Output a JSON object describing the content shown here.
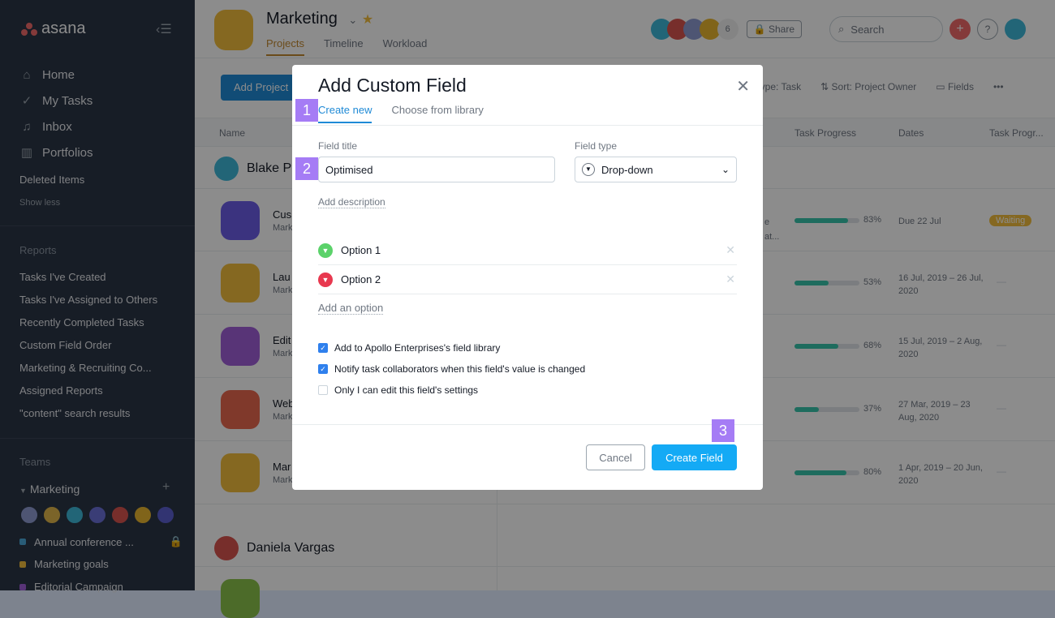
{
  "sidebar": {
    "brand": "asana",
    "nav": [
      {
        "icon": "home-icon",
        "label": "Home"
      },
      {
        "icon": "check-circle-icon",
        "label": "My Tasks"
      },
      {
        "icon": "bell-icon",
        "label": "Inbox"
      },
      {
        "icon": "bar-chart-icon",
        "label": "Portfolios"
      }
    ],
    "deleted": "Deleted Items",
    "show_less": "Show less",
    "reports_heading": "Reports",
    "reports": [
      "Tasks I've Created",
      "Tasks I've Assigned to Others",
      "Recently Completed Tasks",
      "Custom Field Order",
      "Marketing & Recruiting Co...",
      "Assigned Reports",
      "\"content\" search results"
    ],
    "teams_heading": "Teams",
    "team": "Marketing",
    "projects": [
      {
        "label": "Annual conference ...",
        "color": "#4ba8d9"
      },
      {
        "label": "Marketing goals",
        "color": "#f1bd3c"
      },
      {
        "label": "Editorial Campaign",
        "color": "#a05fd8"
      }
    ]
  },
  "header": {
    "title": "Marketing",
    "tabs": [
      "Projects",
      "Timeline",
      "Workload"
    ],
    "member_count": "6",
    "share": "Share",
    "search_placeholder": "Search",
    "help": "?"
  },
  "toolbar": {
    "add_project": "Add Project",
    "filter": "Type: Task",
    "sort": "Sort: Project Owner",
    "fields": "Fields",
    "more": "•••"
  },
  "columns": {
    "name": "Name",
    "task_progress": "Task Progress",
    "dates": "Dates",
    "task_progress2": "Task Progr..."
  },
  "groups": [
    "Blake P",
    "Daniela Vargas"
  ],
  "rows": [
    {
      "name": "Cus",
      "sub": "Mark",
      "color": "#6b5ce7",
      "progress": 83,
      "pct": "83%",
      "dates": "Due 22 Jul",
      "status": "Waiting",
      "snippet": "e\nat..."
    },
    {
      "name": "Lau",
      "sub": "Mark",
      "color": "#f1bd3c",
      "progress": 53,
      "pct": "53%",
      "dates": "16 Jul, 2019 – 26 Jul, 2020",
      "status": "—"
    },
    {
      "name": "Edit",
      "sub": "Mark",
      "color": "#a05fd8",
      "progress": 68,
      "pct": "68%",
      "dates": "15 Jul, 2019 – 2 Aug, 2020",
      "status": "—"
    },
    {
      "name": "Web",
      "sub": "Mark",
      "color": "#e8674f",
      "progress": 37,
      "pct": "37%",
      "dates": "27 Mar, 2019 – 23 Aug, 2020",
      "status": "—"
    },
    {
      "name": "Mar",
      "sub": "Mark",
      "color": "#f1bd3c",
      "progress": 80,
      "pct": "80%",
      "dates": "1 Apr, 2019 – 20 Jun, 2020",
      "status": "—"
    }
  ],
  "modal": {
    "title": "Add Custom Field",
    "tabs": [
      "Create new",
      "Choose from library"
    ],
    "field_title_label": "Field title",
    "field_title_value": "Optimised",
    "field_type_label": "Field type",
    "field_type_value": "Drop-down",
    "add_description": "Add description",
    "options": [
      {
        "label": "Option 1",
        "color": "#5bd26a"
      },
      {
        "label": "Option 2",
        "color": "#e8384f"
      }
    ],
    "add_option": "Add an option",
    "checkboxes": [
      {
        "label": "Add to Apollo Enterprises's field library",
        "checked": true
      },
      {
        "label": "Notify task collaborators when this field's value is changed",
        "checked": true
      },
      {
        "label": "Only I can edit this field's settings",
        "checked": false
      }
    ],
    "cancel": "Cancel",
    "create": "Create Field"
  },
  "steps": [
    "1",
    "2",
    "3"
  ],
  "colors": {
    "accent": "#14aaf5",
    "step": "#a57cf5",
    "progress": "#37c5ab"
  }
}
